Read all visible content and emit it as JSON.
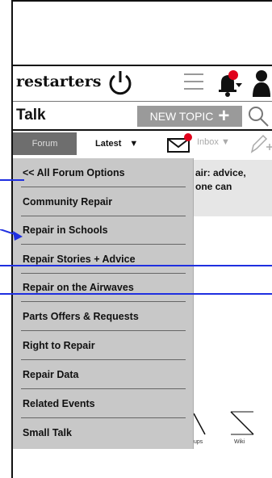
{
  "header": {
    "logo": "restarters"
  },
  "talkbar": {
    "title": "Talk",
    "new_topic": "NEW TOPIC"
  },
  "tabs": {
    "forum": "Forum",
    "latest": "Latest",
    "inbox": "Inbox ▼"
  },
  "preview": {
    "text": "air: advice,\none can"
  },
  "dropdown": {
    "items": [
      "<< All Forum Options",
      "Community Repair",
      "Repair in Schools",
      "Repair Stories + Advice",
      "Repair on the Airwaves",
      "Parts Offers & Requests",
      "Right to Repair",
      "Repair Data",
      "Related Events",
      "Small Talk"
    ]
  },
  "bottom": {
    "groups_fragment": "ups",
    "wiki": "Wiki"
  },
  "colors": {
    "accent": "#1f2fe0",
    "notification": "#e0001b",
    "tab_active": "#6e6e6e",
    "dropdown_bg": "#c8c8c8"
  }
}
